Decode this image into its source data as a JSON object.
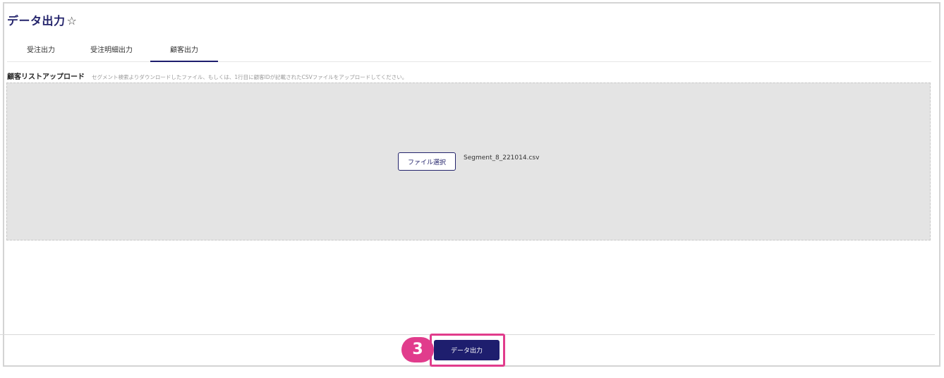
{
  "page": {
    "title": "データ出力",
    "favorite_icon": "☆"
  },
  "tabs": [
    {
      "label": "受注出力",
      "active": false
    },
    {
      "label": "受注明細出力",
      "active": false
    },
    {
      "label": "顧客出力",
      "active": true
    }
  ],
  "upload": {
    "label": "顧客リストアップロード",
    "help": "セグメント検索よりダウンロードしたファイル、もしくは、1行目に顧客IDが記載されたCSVファイルをアップロードしてください。",
    "file_button_label": "ファイル選択",
    "file_name": "Segment_8_221014.csv"
  },
  "footer": {
    "step_number": "3",
    "export_button_label": "データ出力",
    "highlight_color": "#e13c8c",
    "accent_color": "#1e1e6e"
  }
}
